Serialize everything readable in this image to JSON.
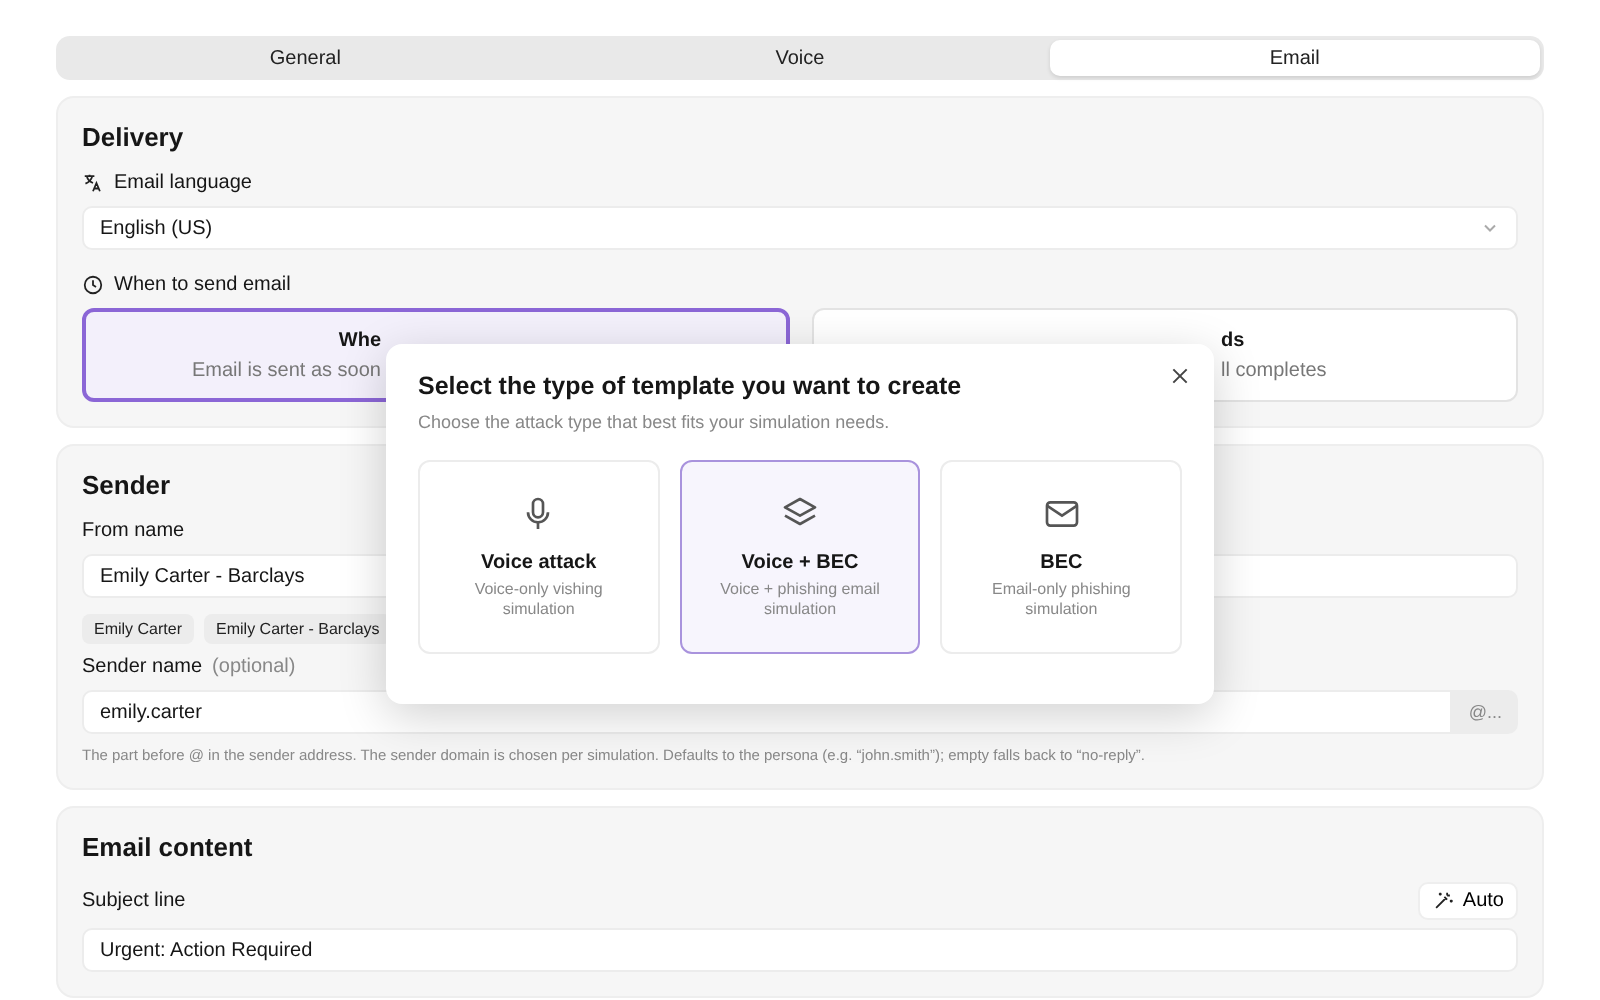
{
  "tabs": [
    {
      "label": "General",
      "selected": false
    },
    {
      "label": "Voice",
      "selected": false
    },
    {
      "label": "Email",
      "selected": true
    }
  ],
  "delivery": {
    "title": "Delivery",
    "language_label": "Email language",
    "language_value": "English (US)",
    "when_label": "When to send email",
    "options": [
      {
        "title": "Whe",
        "description": "Email is sent as soon",
        "selected": true
      },
      {
        "title": "ds",
        "description": "ll completes",
        "selected": false
      }
    ]
  },
  "sender": {
    "title": "Sender",
    "from_name_label": "From name",
    "from_name_value": "Emily Carter - Barclays",
    "suggestions": [
      "Emily Carter",
      "Emily Carter - Barclays"
    ],
    "sender_name_label": "Sender name",
    "sender_name_optional": "(optional)",
    "sender_name_value": "emily.carter",
    "domain_suffix": "@...",
    "help": "The part before @ in the sender address. The sender domain is chosen per simulation. Defaults to the persona (e.g. “john.smith”); empty falls back to “no-reply”."
  },
  "email_content": {
    "title": "Email content",
    "subject_label": "Subject line",
    "auto_button": "Auto",
    "subject_value": "Urgent: Action Required"
  },
  "modal": {
    "title": "Select the type of template you want to create",
    "subtitle": "Choose the attack type that best fits your simulation needs.",
    "options": [
      {
        "kind": "mic",
        "title": "Voice attack",
        "description": "Voice-only vishing simulation",
        "selected": false
      },
      {
        "kind": "layers",
        "title": "Voice + BEC",
        "description": "Voice + phishing email simulation",
        "selected": true
      },
      {
        "kind": "mail",
        "title": "BEC",
        "description": "Email-only phishing simulation",
        "selected": false
      }
    ]
  }
}
